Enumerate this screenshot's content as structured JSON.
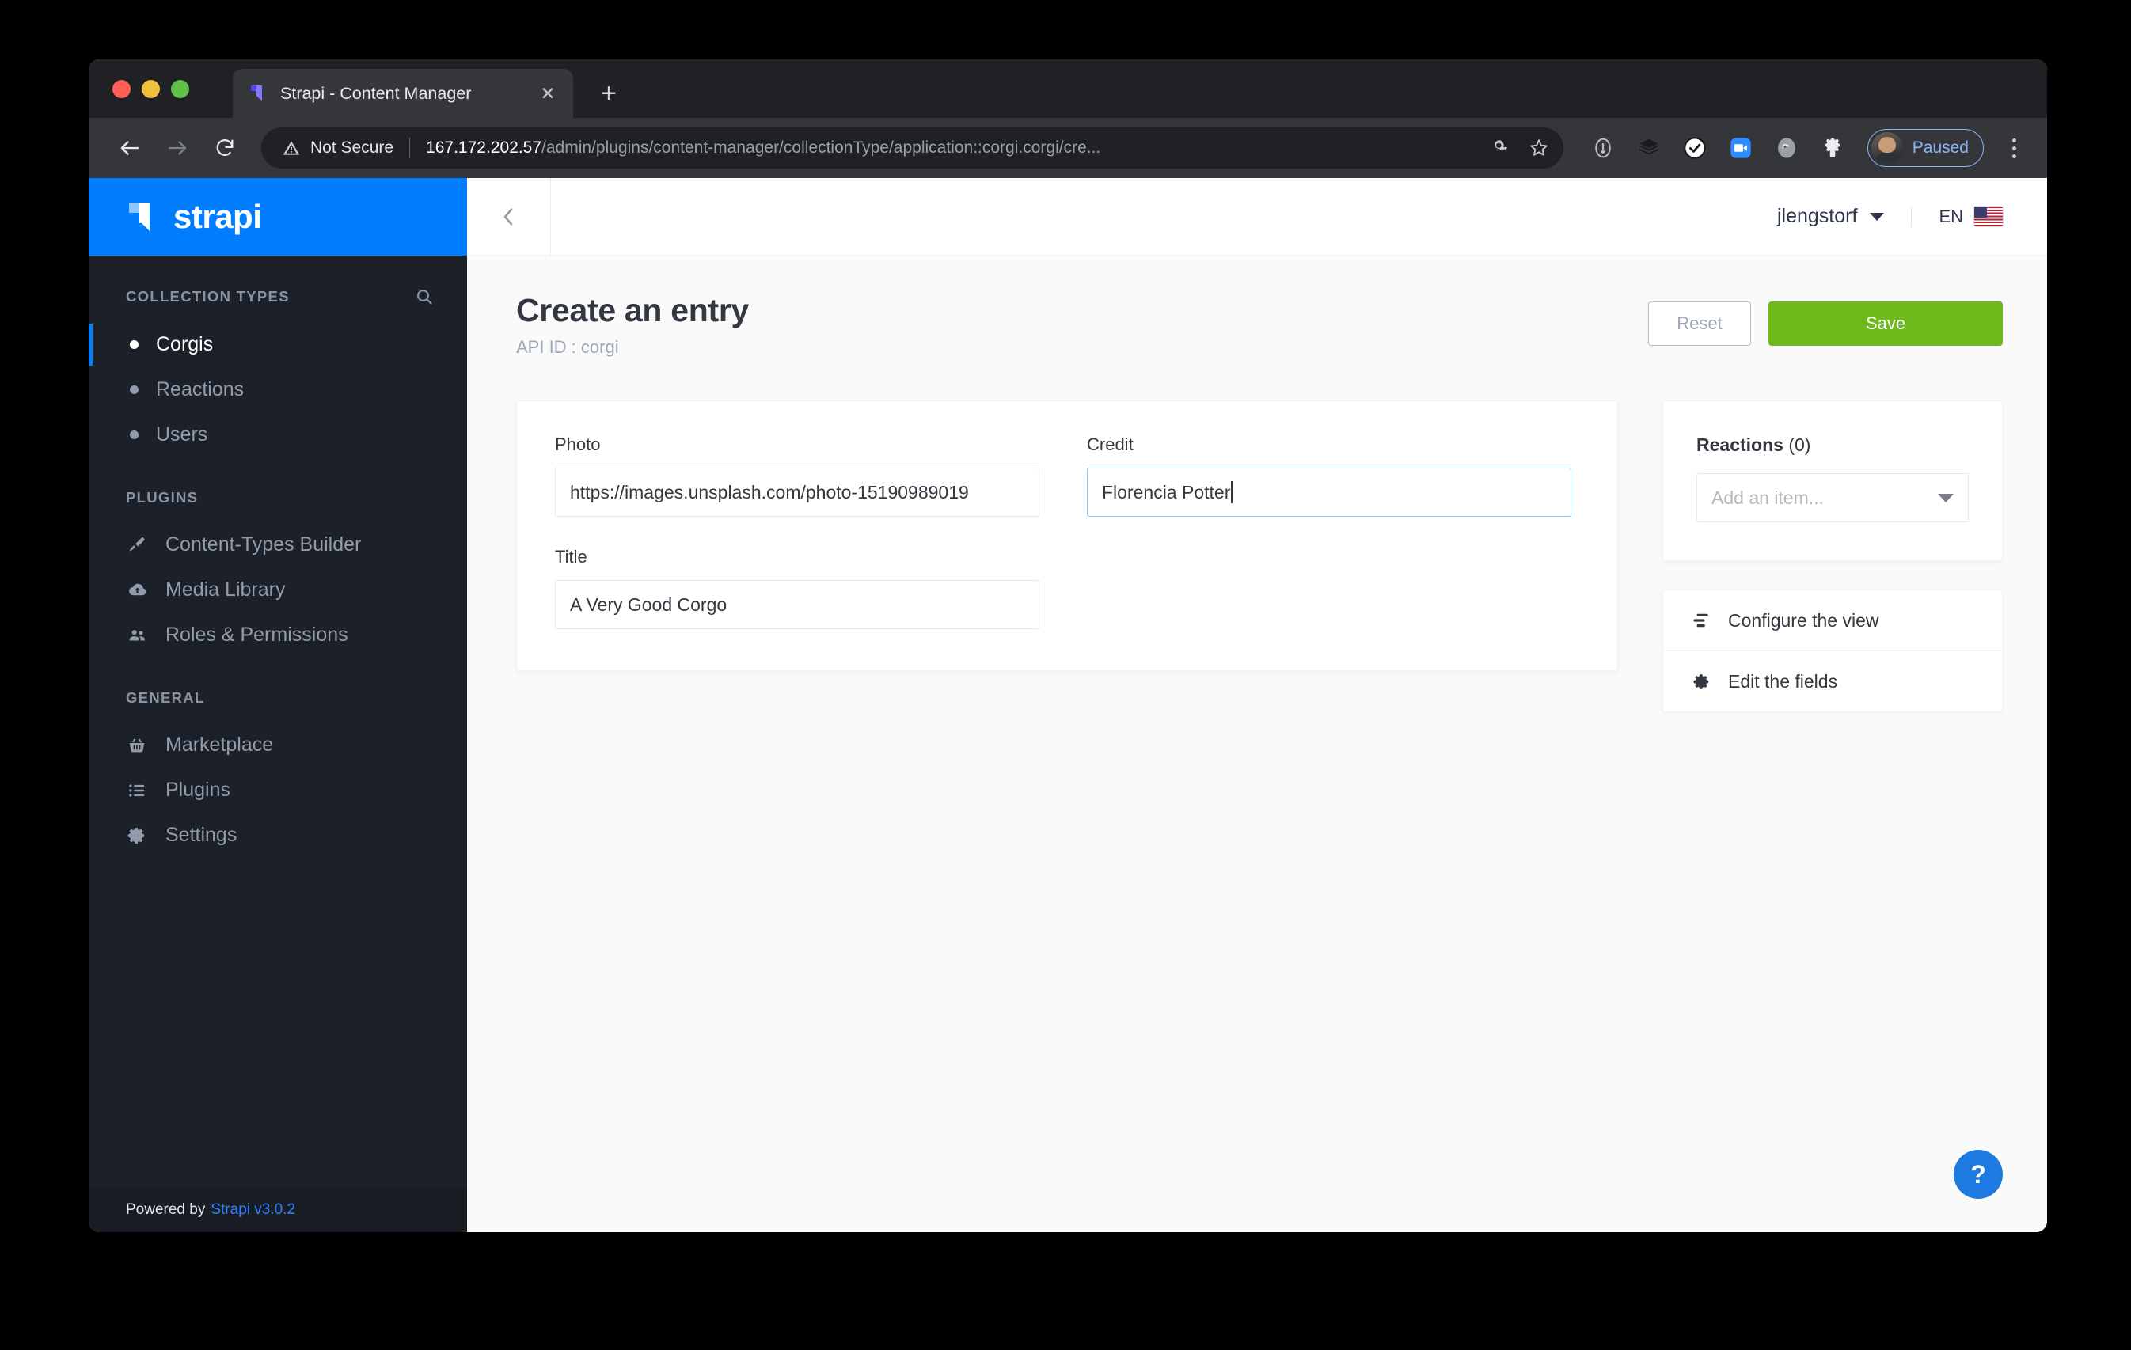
{
  "browser": {
    "tab": {
      "title": "Strapi - Content Manager",
      "close_label": "✕",
      "favicon_name": "strapi-favicon"
    },
    "new_tab_label": "+",
    "omnibox": {
      "security_label": "Not Secure",
      "url_host": "167.172.202.57",
      "url_path": "/admin/plugins/content-manager/collectionType/application::corgi.corgi/cre...",
      "full_url": "167.172.202.57/admin/plugins/content-manager/collectionType/application::corgi.corgi/cre..."
    },
    "profile": {
      "label": "Paused"
    },
    "toolbar_icons": [
      "back-icon",
      "forward-icon",
      "reload-icon",
      "warning-icon",
      "password-key-icon",
      "bookmark-star-icon",
      "info-circle-icon",
      "layers-icon",
      "checkmark-circle-icon",
      "zoom-video-icon",
      "ghost-icon",
      "puzzle-extension-icon",
      "kebab-menu-icon"
    ]
  },
  "sidebar": {
    "brand": "strapi",
    "collection_types_title": "COLLECTION TYPES",
    "collection_types": [
      {
        "label": "Corgis",
        "active": true
      },
      {
        "label": "Reactions",
        "active": false
      },
      {
        "label": "Users",
        "active": false
      }
    ],
    "plugins_title": "PLUGINS",
    "plugins": [
      {
        "label": "Content-Types Builder",
        "icon": "paintbrush-icon"
      },
      {
        "label": "Media Library",
        "icon": "cloud-upload-icon"
      },
      {
        "label": "Roles & Permissions",
        "icon": "users-group-icon"
      }
    ],
    "general_title": "GENERAL",
    "general": [
      {
        "label": "Marketplace",
        "icon": "shopping-basket-icon"
      },
      {
        "label": "Plugins",
        "icon": "list-icon"
      },
      {
        "label": "Settings",
        "icon": "gear-icon"
      }
    ],
    "footer_prefix": "Powered by",
    "footer_link": "Strapi v3.0.2"
  },
  "topbar": {
    "user": "jlengstorf",
    "language": "EN",
    "flag": "us-flag-icon"
  },
  "header": {
    "title": "Create an entry",
    "subtitle": "API ID : corgi",
    "reset_label": "Reset",
    "save_label": "Save"
  },
  "form": {
    "photo": {
      "label": "Photo",
      "value": "https://images.unsplash.com/photo-15190989019",
      "placeholder": ""
    },
    "credit": {
      "label": "Credit",
      "value": "Florencia Potter",
      "placeholder": "",
      "focused": true
    },
    "title": {
      "label": "Title",
      "value": "A Very Good Corgo",
      "placeholder": ""
    }
  },
  "relations": {
    "title_bold": "Reactions",
    "title_count": " (0)",
    "select_placeholder": "Add an item..."
  },
  "side_links": [
    {
      "label": "Configure the view",
      "icon": "sliders-icon"
    },
    {
      "label": "Edit the fields",
      "icon": "gear-icon"
    }
  ],
  "help": {
    "label": "?"
  },
  "colors": {
    "brand_blue": "#007eff",
    "save_green": "#6dbb1a",
    "sidebar_bg": "#1c2129",
    "focus_border": "#78caff",
    "link_blue": "#2f80ff"
  }
}
